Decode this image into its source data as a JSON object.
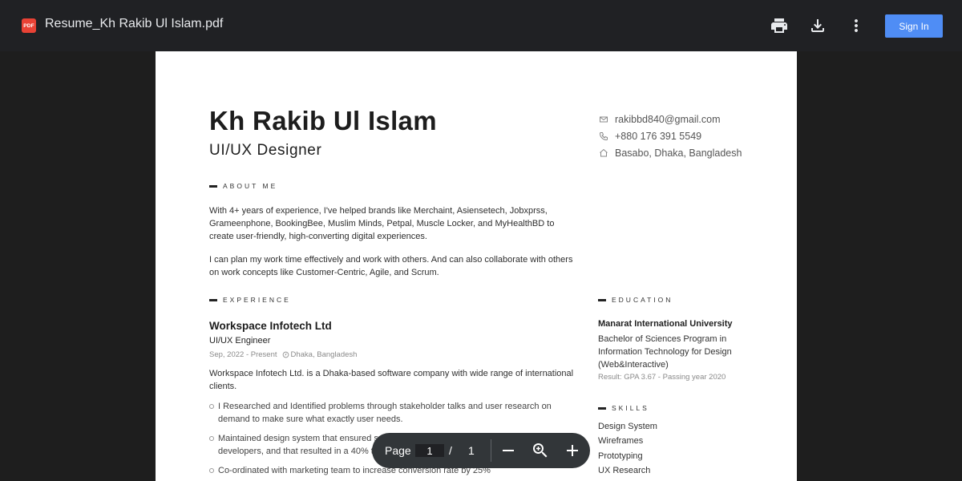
{
  "toolbar": {
    "badge": "PDF",
    "file_title": "Resume_Kh Rakib Ul Islam.pdf",
    "sign_in_label": "Sign In"
  },
  "resume": {
    "name": "Kh Rakib Ul Islam",
    "role": "UI/UX Designer",
    "contact": {
      "email": "rakibbd840@gmail.com",
      "phone": "+880 176 391 5549",
      "address": "Basabo, Dhaka, Bangladesh"
    },
    "about": {
      "heading": "ABOUT ME",
      "paragraphs": [
        "With 4+ years of experience, I've helped brands like Merchaint, Asiensetech, Jobxprss, Grameenphone, BookingBee, Muslim Minds, Petpal, Muscle Locker, and MyHealthBD to create user-friendly, high-converting digital experiences.",
        "I can plan my work time effectively and work with others. And can also collaborate with others on work concepts like Customer-Centric, Agile, and Scrum."
      ]
    },
    "experience": {
      "heading": "EXPERIENCE",
      "company": "Workspace Infotech Ltd",
      "title": "UI/UX Engineer",
      "dates": "Sep, 2022 - Present",
      "location": "Dhaka, Bangladesh",
      "description": "Workspace Infotech Ltd. is a Dhaka-based software company with wide range of international clients.",
      "bullets": [
        "I Researched and Identified problems through stakeholder talks and user research on demand to make sure what exactly user needs.",
        "Maintained design system that ensured smooth work processes for designers and developers, and that resulted in a 40% time saving.",
        "Co-ordinated with marketing team to increase conversion rate by 25%"
      ]
    },
    "education": {
      "heading": "EDUCATION",
      "school": "Manarat International University",
      "program": "Bachelor of Sciences Program in Information Technology for Design (Web&Interactive)",
      "result": "Result: GPA 3.67 - Passing year 2020"
    },
    "skills": {
      "heading": "SKILLS",
      "items": [
        "Design System",
        "Wireframes",
        "Prototyping",
        "UX Research"
      ]
    }
  },
  "page_control": {
    "label": "Page",
    "current": "1",
    "separator": "/",
    "total": "1"
  },
  "colors": {
    "toolbar_bg": "#202124",
    "accent": "#4f8df5",
    "pdf_badge": "#e94235"
  }
}
